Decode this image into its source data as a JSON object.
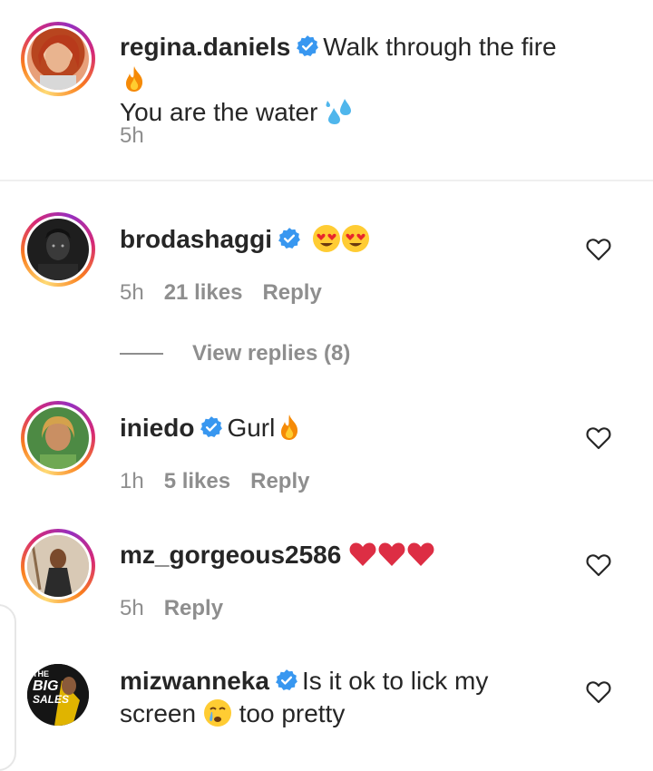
{
  "caption": {
    "username": "regina.daniels",
    "text_line1": "Walk through the fire",
    "text_line2": "You are the water",
    "time": "5h"
  },
  "comments": [
    {
      "username": "brodashaggi",
      "text": "",
      "time": "5h",
      "likes": "21 likes",
      "reply": "Reply"
    },
    {
      "username": "iniedo",
      "text": "Gurl",
      "time": "1h",
      "likes": "5 likes",
      "reply": "Reply"
    },
    {
      "username": "mz_gorgeous2586",
      "text": "",
      "time": "5h",
      "reply": "Reply"
    },
    {
      "username": "mizwanneka",
      "text_line1": "Is it ok to lick my",
      "text_line2a": "screen",
      "text_line2b": "too pretty"
    }
  ],
  "view_replies": "View replies (8)",
  "avatar_mizwanneka": {
    "line1": "THE",
    "line2": "BIG",
    "line3": "SALES"
  },
  "colors": {
    "verified": "#3897f0",
    "muted": "#8e8e8e",
    "text": "#262626"
  },
  "icons": [
    "verified-badge-icon",
    "heart-outline-icon",
    "fire-emoji",
    "droplets-emoji",
    "heart-eyes-emoji",
    "red-heart-emoji",
    "crying-face-emoji"
  ]
}
